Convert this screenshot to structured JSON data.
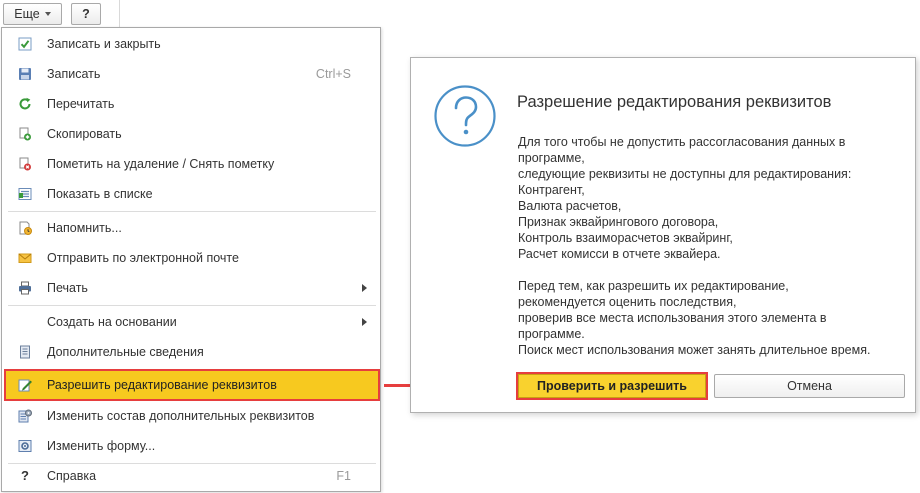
{
  "toolbar": {
    "more_label": "Еще",
    "help_label": "?"
  },
  "menu": {
    "items": [
      {
        "label": "Записать и закрыть",
        "shortcut": "",
        "icon": "save-close-icon"
      },
      {
        "label": "Записать",
        "shortcut": "Ctrl+S",
        "icon": "floppy-disk-icon"
      },
      {
        "label": "Перечитать",
        "shortcut": "",
        "icon": "refresh-icon"
      },
      {
        "label": "Скопировать",
        "shortcut": "",
        "icon": "copy-icon"
      },
      {
        "label": "Пометить на удаление / Снять пометку",
        "shortcut": "",
        "icon": "mark-delete-icon"
      },
      {
        "label": "Показать в списке",
        "shortcut": "",
        "icon": "show-in-list-icon"
      },
      {
        "label": "Напомнить...",
        "shortcut": "",
        "icon": "reminder-icon"
      },
      {
        "label": "Отправить по электронной почте",
        "shortcut": "",
        "icon": "envelope-icon"
      },
      {
        "label": "Печать",
        "shortcut": "",
        "icon": "printer-icon"
      },
      {
        "label": "Создать на основании",
        "shortcut": "",
        "icon": ""
      },
      {
        "label": "Дополнительные сведения",
        "shortcut": "",
        "icon": "info-document-icon"
      },
      {
        "label": "Разрешить редактирование реквизитов",
        "shortcut": "",
        "icon": "edit-pencil-icon"
      },
      {
        "label": "Изменить состав дополнительных реквизитов",
        "shortcut": "",
        "icon": "properties-settings-icon"
      },
      {
        "label": "Изменить форму...",
        "shortcut": "",
        "icon": "form-settings-icon"
      },
      {
        "label": "Справка",
        "shortcut": "F1",
        "icon": "help-question-icon"
      }
    ]
  },
  "dialog": {
    "title": "Разрешение редактирования реквизитов",
    "lines": [
      "Для того чтобы не допустить рассогласования данных в",
      "программе,",
      "следующие реквизиты не доступны для редактирования:",
      "Контрагент,",
      "Валюта расчетов,",
      "Признак эквайрингового договора,",
      "Контроль взаиморасчетов эквайринг,",
      "Расчет комисси в отчете эквайера.",
      "",
      "Перед тем, как разрешить их редактирование,",
      "рекомендуется оценить последствия,",
      "проверив все места использования этого элемента в",
      "программе.",
      "Поиск мест использования может занять длительное время."
    ],
    "ok_label": "Проверить и разрешить",
    "cancel_label": "Отмена"
  },
  "colors": {
    "highlight": "#f7c91f",
    "callout_red": "#e63e3e",
    "dialog_icon": "#4a90c8",
    "primary_button": "#f9d22e"
  }
}
